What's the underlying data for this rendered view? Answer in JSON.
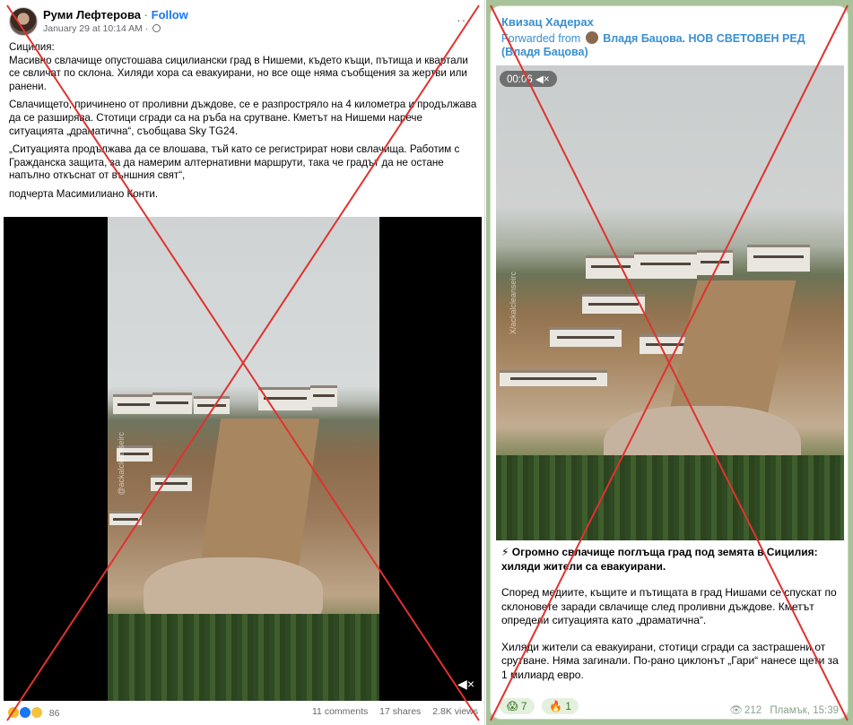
{
  "facebook": {
    "author": "Руми Лефтерова",
    "separator": "·",
    "follow_label": "Follow",
    "date": "January 29 at 10:14 AM ·",
    "more_label": "···",
    "paragraphs": [
      "Сицилия:\nМасивно свлачище опустошава сицилиански град в Нишеми, където къщи, пътища и квартали се свличат по склона. Хиляди хора са евакуирани, но все още няма съобщения за жертви или ранени.",
      "Свлачището, причинено от проливни дъждове, се е разпростряло на 4 километра и продължава да се разширява. Стотици сгради са на ръба на срутване. Кметът на Нишеми нарече ситуацията „драматична“, съобщава Sky TG24.",
      "„Ситуацията продължава да се влошава, тъй като се регистрират нови свлачища. Работим с Гражданска защита, за да намерим алтернативни маршрути, така че градът да не остане напълно откъснат от външния свят“,",
      "подчерта Масимилиано Конти."
    ],
    "watermark": "@ackalcleanseirc",
    "reaction_count": "86",
    "comments": "11 comments",
    "shares": "17 shares",
    "views": "2.8K views"
  },
  "telegram": {
    "channel": "Квизац Хадерах",
    "forwarded_prefix": "Forwarded from",
    "forwarded_from": "Владя Бацова. НОВ СВЕТОВЕН РЕД (Владя Бацова)",
    "video_time": "00:06",
    "watermark": "X/ackalcleanseirc",
    "lead": "⚡ Огромно свлачище поглъща град под земята в Сицилия: хиляди жители са евакуирани.",
    "para1": "Според медиите, къщите и пътищата в град Нишами се спускат по склоновете заради свлачище след проливни дъждове. Кметът определи ситуацията като „драматична“.",
    "para2": "Хиляди жители са евакуирани, стотици сгради са застрашени от срутване. Няма загинали. По-рано циклонът „Гари“ нанесе щети за 1 милиард евро.",
    "reactions": [
      {
        "emoji": "😱",
        "count": "7"
      },
      {
        "emoji": "🔥",
        "count": "1"
      }
    ],
    "views": "212",
    "author_time": "Пламък, 15:39"
  },
  "colors": {
    "fb_blue": "#1877f2",
    "tg_link": "#3a8fd0",
    "cross_red": "#e0322f"
  }
}
